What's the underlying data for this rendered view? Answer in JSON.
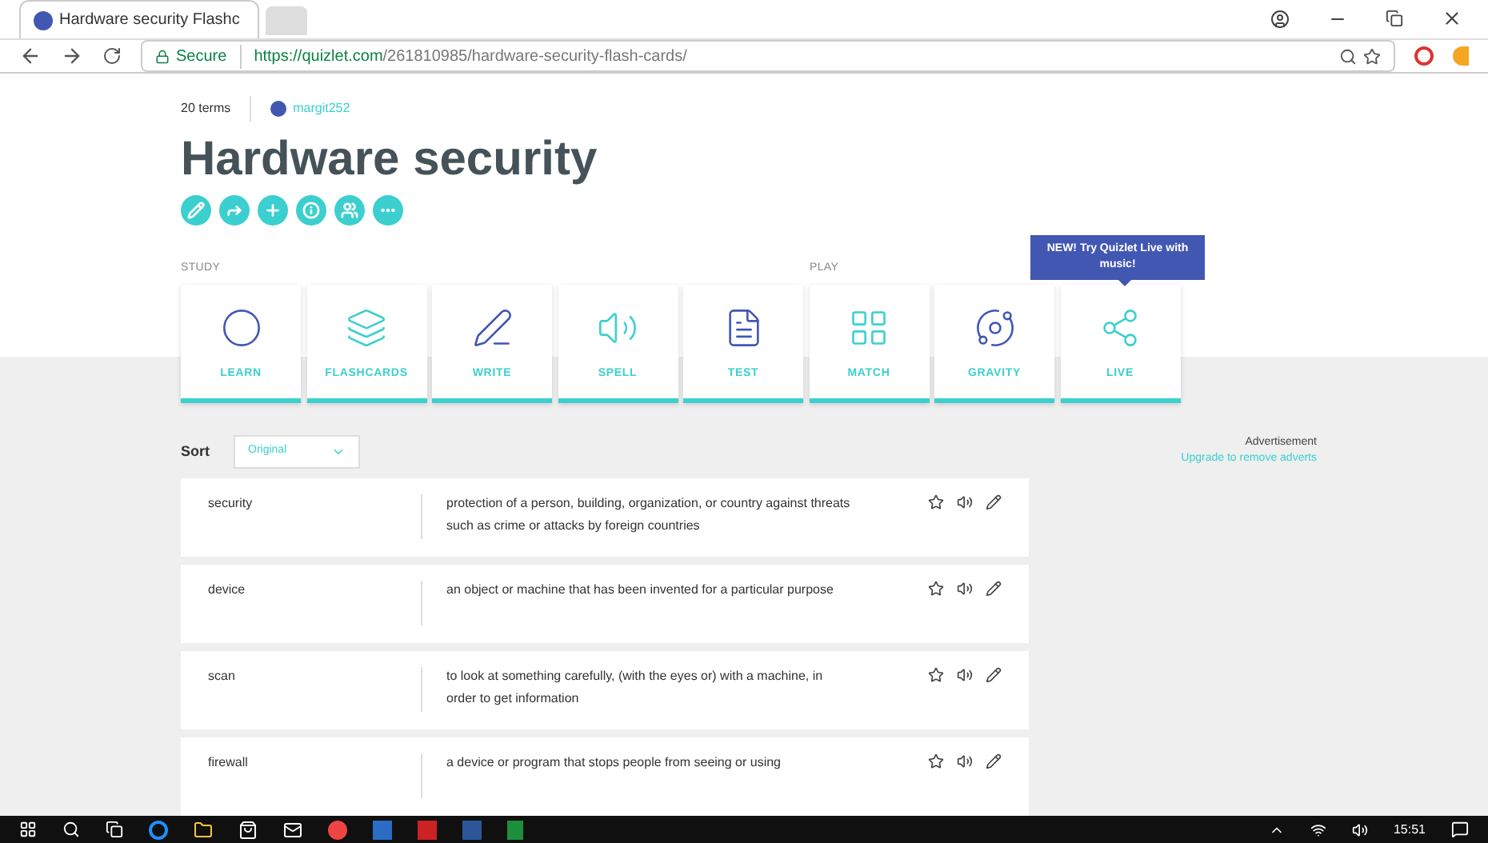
{
  "browser": {
    "tab_title": "Hardware security Flashc",
    "url_secure": "Secure",
    "url_host": "https://quizlet.com",
    "url_path": "/261810985/hardware-security-flash-cards/"
  },
  "set": {
    "term_count": "20 terms",
    "author": "margit252",
    "title": "Hardware security"
  },
  "sections": {
    "study": "STUDY",
    "play": "PLAY"
  },
  "tooltip": "NEW! Try Quizlet Live with music!",
  "modes": [
    {
      "kind": "learn",
      "label": "LEARN"
    },
    {
      "kind": "flashcards",
      "label": "FLASHCARDS"
    },
    {
      "kind": "write",
      "label": "WRITE"
    },
    {
      "kind": "spell",
      "label": "SPELL"
    },
    {
      "kind": "test",
      "label": "TEST"
    },
    {
      "kind": "match",
      "label": "MATCH"
    },
    {
      "kind": "gravity",
      "label": "GRAVITY"
    },
    {
      "kind": "live",
      "label": "LIVE"
    }
  ],
  "sort": {
    "label": "Sort",
    "value": "Original"
  },
  "ad": {
    "label": "Advertisement",
    "link": "Upgrade to remove adverts"
  },
  "terms": [
    {
      "term": "security",
      "definition": "protection of a person, building, organization, or country against threats such as crime or attacks by foreign countries"
    },
    {
      "term": "device",
      "definition": "an object or machine that has been invented for a particular purpose"
    },
    {
      "term": "scan",
      "definition": "to look at something carefully, (with the eyes or) with a machine, in order to get information"
    },
    {
      "term": "firewall",
      "definition": "a device or program that stops people from seeing or using"
    }
  ],
  "taskbar": {
    "time": "15:51"
  }
}
